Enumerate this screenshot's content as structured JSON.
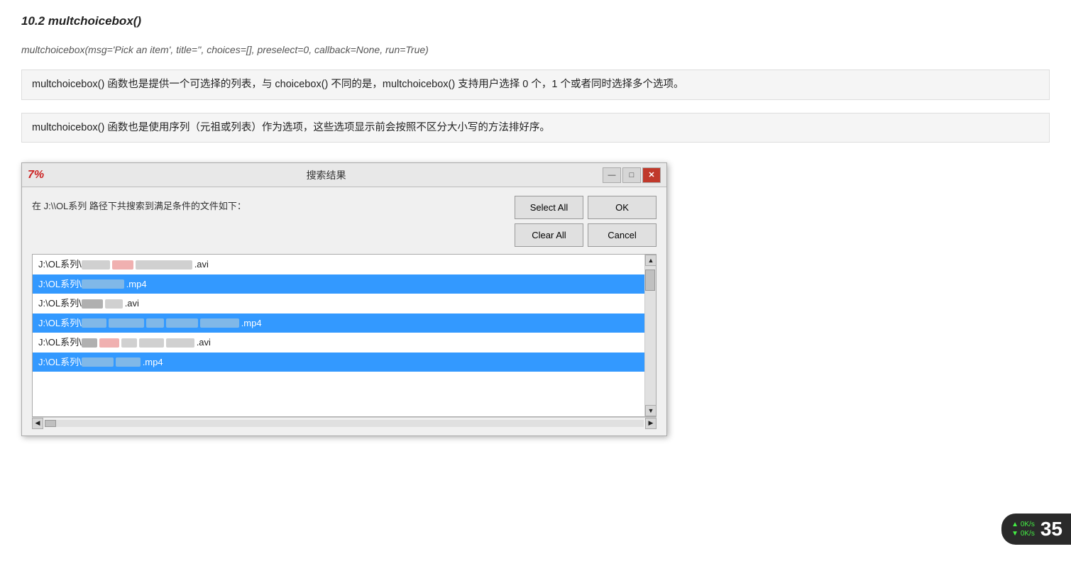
{
  "section": {
    "title": "10.2 multchoicebox()",
    "signature": "multchoicebox(msg='Pick an item', title='', choices=[], preselect=0, callback=None, run=True)",
    "desc1": "multchoicebox() 函数也是提供一个可选择的列表，与 choicebox() 不同的是，multchoicebox() 支持用户选择 0 个，1 个或者同时选择多个选项。",
    "desc2": "multchoicebox() 函数也是使用序列（元祖或列表）作为选项，这些选项显示前会按照不区分大小写的方法排好序。"
  },
  "dialog": {
    "icon": "7%",
    "title": "搜索结果",
    "msg": "在 J:\\\\OL系列 路径下共搜索到满足条件的文件如下：",
    "buttons": {
      "select_all": "Select All",
      "ok": "OK",
      "clear_all": "Clear All",
      "cancel": "Cancel"
    },
    "win_controls": {
      "minimize": "—",
      "maximize": "□",
      "close": "✕"
    },
    "list_items": [
      {
        "text_prefix": "J:\\OL系列\\",
        "suffix": ".avi",
        "selected": false,
        "has_blur": true
      },
      {
        "text_prefix": "J:\\OL系列\\",
        "suffix": ".mp4",
        "selected": true,
        "has_blur": true
      },
      {
        "text_prefix": "J:\\OL系列\\",
        "suffix": ".avi",
        "selected": false,
        "has_blur": true
      },
      {
        "text_prefix": "J:\\OL系列\\",
        "suffix": ".mp4",
        "selected": true,
        "has_blur": true
      },
      {
        "text_prefix": "J:\\OL系列\\",
        "suffix": ".avi",
        "selected": false,
        "has_blur": true
      },
      {
        "text_prefix": "J:\\OL系列\\",
        "suffix": ".mp4",
        "selected": true,
        "has_blur": true
      }
    ]
  },
  "speed_widget": {
    "up_label": "0K/s",
    "down_label": "0K/s",
    "number": "35"
  }
}
